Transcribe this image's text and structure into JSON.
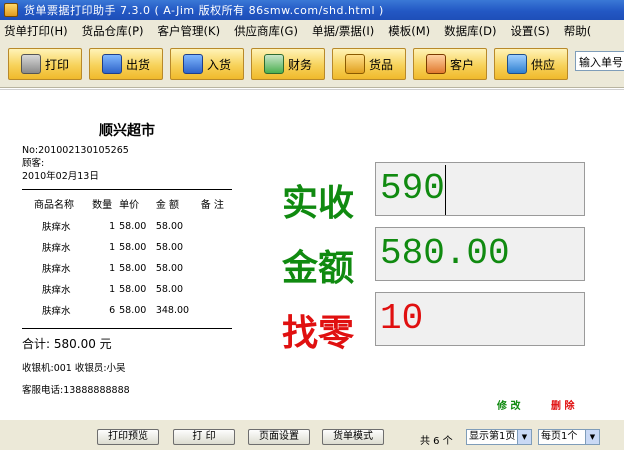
{
  "window": {
    "title": "货单票据打印助手 7.3.0 ( A-Jim 版权所有 86smw.com/shd.html )"
  },
  "menu": [
    "货单打印(H)",
    "货品仓库(P)",
    "客户管理(K)",
    "供应商库(G)",
    "单据/票据(I)",
    "模板(M)",
    "数据库(D)",
    "设置(S)",
    "帮助("
  ],
  "toolbar": {
    "print": "打印",
    "out": "出货",
    "in": "入货",
    "finance": "财务",
    "goods": "货品",
    "customer": "客户",
    "supply": "供应",
    "search_value": "输入单号"
  },
  "receipt": {
    "shop_name": "顺兴超市",
    "number": "No:201002130105265",
    "customer": "顾客:",
    "date": "2010年02月13日",
    "headers": [
      "商品名称",
      "数量",
      "单价",
      "金 额",
      "备 注"
    ],
    "rows": [
      [
        "肤痒水",
        "1",
        "58.00",
        "58.00",
        ""
      ],
      [
        "肤痒水",
        "1",
        "58.00",
        "58.00",
        ""
      ],
      [
        "肤痒水",
        "1",
        "58.00",
        "58.00",
        ""
      ],
      [
        "肤痒水",
        "1",
        "58.00",
        "58.00",
        ""
      ],
      [
        "肤痒水",
        "6",
        "58.00",
        "348.00",
        ""
      ]
    ],
    "total": "合计:   580.00 元",
    "cashier": "收银机:001  收银员:小吴",
    "phone": "客服电话:13888888888"
  },
  "fields": {
    "received_label": "实收",
    "received_value": "590",
    "amount_label": "金额",
    "amount_value": "580.00",
    "change_label": "找零",
    "change_value": "10"
  },
  "actions": {
    "edit": "修 改",
    "delete": "删 除"
  },
  "bottom": {
    "preview": "打印预览",
    "print": "打 印",
    "page_setup": "页面设置",
    "mode": "货单模式",
    "count": "共 6 个",
    "page_select": "显示第1页",
    "per_page_select": "每页1个"
  },
  "colors": {
    "green_label": "#108a10",
    "red_label": "#e01010",
    "toolbar_button": "#f7d25a"
  }
}
